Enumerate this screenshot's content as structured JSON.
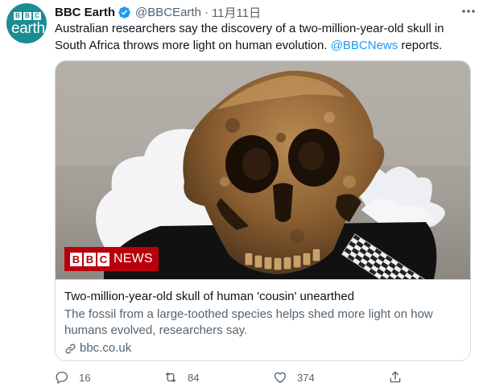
{
  "tweet": {
    "author_name": "BBC Earth",
    "handle": "@BBCEarth",
    "separator": "·",
    "date": "11月11日",
    "text_before": "Australian researchers say the discovery of a two-million-year-old skull in South Africa throws more light on human evolution. ",
    "mention": "@BBCNews",
    "text_after": " reports.",
    "avatar": {
      "blocks": [
        "B",
        "B",
        "C"
      ],
      "word": "earth"
    },
    "icons": {
      "verified": "verified-badge-icon",
      "more": "more-options-icon",
      "reply": "reply-icon",
      "retweet": "retweet-icon",
      "like": "heart-icon",
      "share": "share-icon",
      "link": "link-icon"
    }
  },
  "card": {
    "image_alt": "fossil skull on black cloth with cotton and a scale bar",
    "logo_blocks": [
      "B",
      "B",
      "C"
    ],
    "logo_word": "NEWS",
    "title": "Two-million-year-old skull of human 'cousin' unearthed",
    "description": "The fossil from a large-toothed species helps shed more light on how humans evolved, researchers say.",
    "domain": "bbc.co.uk"
  },
  "actions": {
    "reply_count": "16",
    "retweet_count": "84",
    "like_count": "374"
  },
  "colors": {
    "accent": "#1d9bf0",
    "text": "#0f1419",
    "muted": "#536471",
    "border": "#cfd9de",
    "bbc_earth_teal": "#1a8c93",
    "bbc_news_red": "#b8000b"
  }
}
